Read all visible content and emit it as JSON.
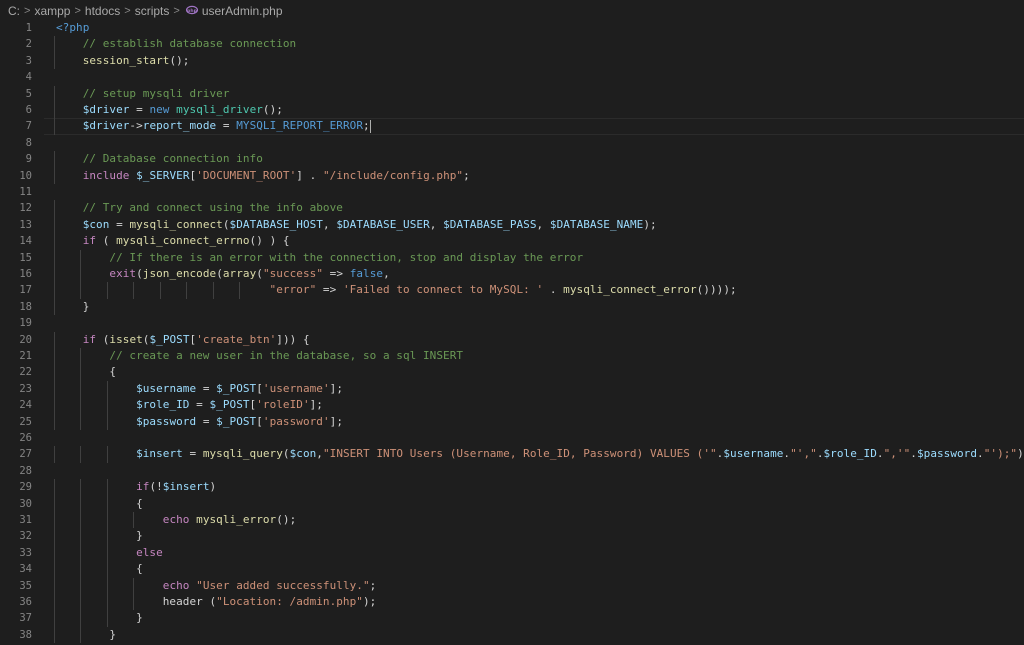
{
  "breadcrumb": {
    "drive": "C:",
    "folders": [
      "xampp",
      "htdocs",
      "scripts"
    ],
    "file_icon": "php-file-icon",
    "file": "userAdmin.php"
  },
  "editor": {
    "language": "php",
    "current_line": 7,
    "lines": [
      {
        "n": "1",
        "text": "<?php"
      },
      {
        "n": "2",
        "text": "    // establish database connection"
      },
      {
        "n": "3",
        "text": "    session_start();"
      },
      {
        "n": "4",
        "text": ""
      },
      {
        "n": "5",
        "text": "    // setup mysqli driver"
      },
      {
        "n": "6",
        "text": "    $driver = new mysqli_driver();"
      },
      {
        "n": "7",
        "text": "    $driver->report_mode = MYSQLI_REPORT_ERROR;"
      },
      {
        "n": "8",
        "text": ""
      },
      {
        "n": "9",
        "text": "    // Database connection info"
      },
      {
        "n": "10",
        "text": "    include $_SERVER['DOCUMENT_ROOT'] . \"/include/config.php\";"
      },
      {
        "n": "11",
        "text": ""
      },
      {
        "n": "12",
        "text": "    // Try and connect using the info above"
      },
      {
        "n": "13",
        "text": "    $con = mysqli_connect($DATABASE_HOST, $DATABASE_USER, $DATABASE_PASS, $DATABASE_NAME);"
      },
      {
        "n": "14",
        "text": "    if ( mysqli_connect_errno() ) {"
      },
      {
        "n": "15",
        "text": "        // If there is an error with the connection, stop and display the error"
      },
      {
        "n": "16",
        "text": "        exit(json_encode(array(\"success\" => false,"
      },
      {
        "n": "17",
        "text": "                                \"error\" => 'Failed to connect to MySQL: ' . mysqli_connect_error())));"
      },
      {
        "n": "18",
        "text": "    }"
      },
      {
        "n": "19",
        "text": ""
      },
      {
        "n": "20",
        "text": "    if (isset($_POST['create_btn'])) {"
      },
      {
        "n": "21",
        "text": "        // create a new user in the database, so a sql INSERT"
      },
      {
        "n": "22",
        "text": "        {"
      },
      {
        "n": "23",
        "text": "            $username = $_POST['username'];"
      },
      {
        "n": "24",
        "text": "            $role_ID = $_POST['roleID'];"
      },
      {
        "n": "25",
        "text": "            $password = $_POST['password'];"
      },
      {
        "n": "26",
        "text": ""
      },
      {
        "n": "27",
        "text": "            $insert = mysqli_query($con,\"INSERT INTO Users (Username, Role_ID, Password) VALUES ('\".$username.\"',\".$role_ID.\",'\".$password.\"');\");"
      },
      {
        "n": "28",
        "text": ""
      },
      {
        "n": "29",
        "text": "            if(!$insert)"
      },
      {
        "n": "30",
        "text": "            {"
      },
      {
        "n": "31",
        "text": "                echo mysqli_error();"
      },
      {
        "n": "32",
        "text": "            }"
      },
      {
        "n": "33",
        "text": "            else"
      },
      {
        "n": "34",
        "text": "            {"
      },
      {
        "n": "35",
        "text": "                echo \"User added successfully.\";"
      },
      {
        "n": "36",
        "text": "                header (\"Location: /admin.php\");"
      },
      {
        "n": "37",
        "text": "            }"
      },
      {
        "n": "38",
        "text": "        }"
      }
    ]
  }
}
